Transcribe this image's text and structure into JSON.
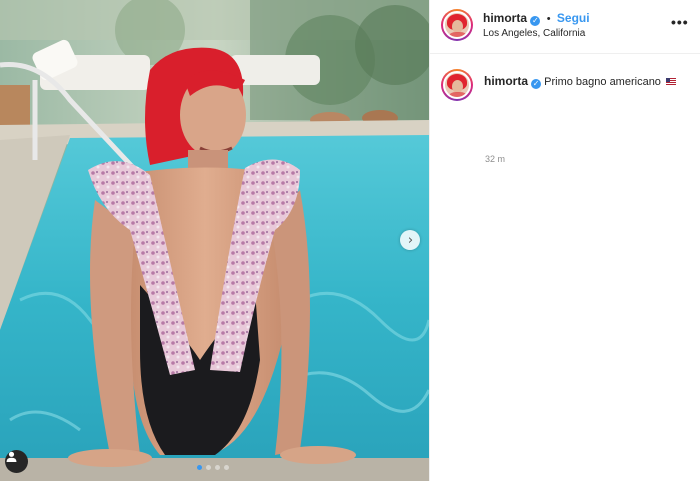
{
  "post": {
    "username": "himorta",
    "verified_icon": "verified-badge-icon",
    "separator": "•",
    "follow_label": "Segui",
    "location": "Los Angeles, California",
    "more_label": "•••",
    "caption_username": "himorta",
    "caption_text": "Primo bagno americano",
    "caption_emoji": "us-flag-icon",
    "timestamp": "32 m"
  },
  "carousel": {
    "next_icon": "chevron-right-icon",
    "next_glyph": "›",
    "tag_icon": "user-tag-icon",
    "slide_count": 4,
    "active_slide": 1
  },
  "colors": {
    "accent": "#3897f0",
    "text": "#262626",
    "muted": "#8e8e8e",
    "pool": "#3fc2d4",
    "hair": "#e0242f"
  }
}
